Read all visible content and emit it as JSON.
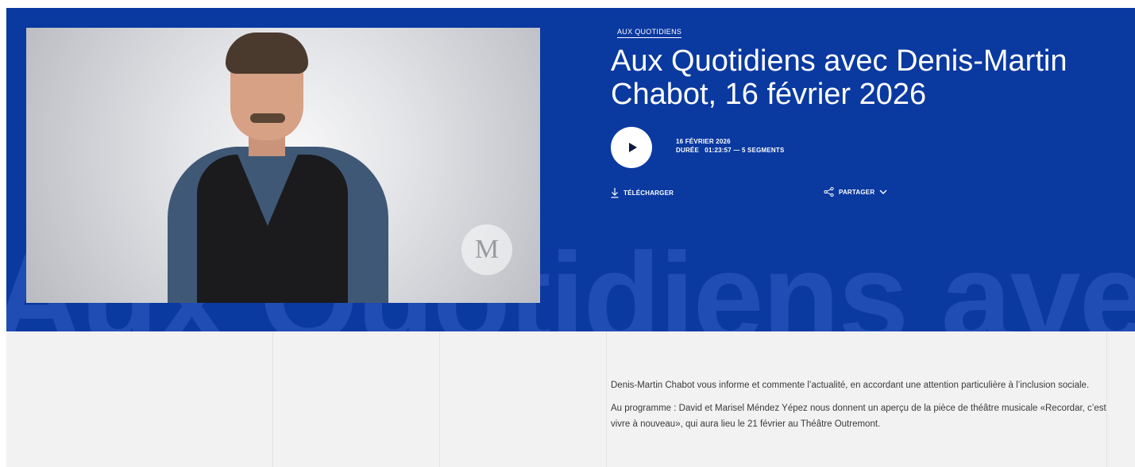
{
  "hero": {
    "watermark": "Aux Quotidiens avec",
    "category": "AUX QUOTIDIENS",
    "title": "Aux Quotidiens avec Denis-Martin Chabot, 16 février 2026",
    "date": "16 FÉVRIER 2026",
    "duration_label": "DURÉE",
    "duration_value": "01:23:57 — 5 SEGMENTS",
    "download_label": "TÉLÉCHARGER",
    "share_label": "PARTAGER",
    "photo_icon": "person-photo",
    "logo_icon": "station-logo-icon",
    "colors": {
      "hero_bg": "#0a39a0",
      "watermark": "#1f4db3",
      "content_bg": "#f2f2f2"
    }
  },
  "description": {
    "paragraphs": [
      "Denis-Martin Chabot vous informe et commente l’actualité, en accordant une attention particulière à l’inclusion sociale.",
      "Au programme : David et Marisel Méndez Yépez nous donnent un aperçu de la pièce de théâtre musicale «Recordar, c’est vivre à nouveau», qui aura lieu le 21 février au Théâtre Outremont."
    ]
  }
}
